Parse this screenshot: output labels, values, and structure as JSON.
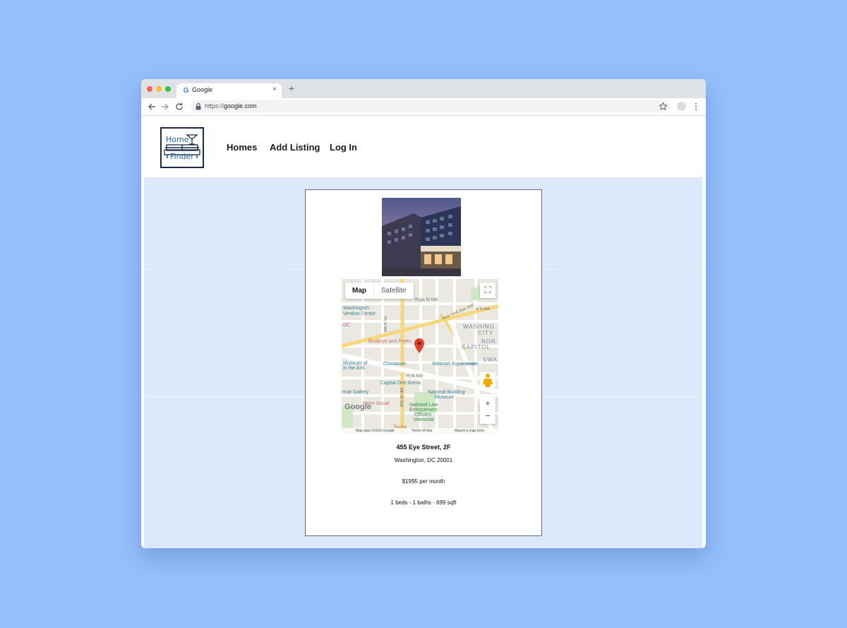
{
  "browser": {
    "tab_title": "Google",
    "tab_favicon": "G",
    "tab_close": "×",
    "new_tab": "+",
    "url_scheme": "https://",
    "url_host": "google.com"
  },
  "site": {
    "logo": {
      "top": "Home",
      "bottom": "Finder"
    },
    "nav": {
      "homes": "Homes",
      "add_listing": "Add Listing",
      "login": "Log In"
    }
  },
  "listing": {
    "map": {
      "tab_map": "Map",
      "tab_satellite": "Satellite",
      "zoom_in": "+",
      "zoom_out": "−",
      "footer_data": "Map data ©2019 Google",
      "footer_terms": "Terms of Use",
      "footer_report": "Report a map error",
      "watermark": "Google",
      "labels": {
        "rigia": "Rigia St NW",
        "nyave": "New York Ave NW",
        "mst": "M St NW",
        "washington_center": "Washington",
        "washington_center2": "Vention Center",
        "dc": "DC",
        "washington": "WASHING",
        "city": "CITY",
        "nor": "NOR",
        "capitol": "CAPITOL",
        "busboys": "Busboys and Poets",
        "museum": "Museum of",
        "in_the_arts": "in the Arts",
        "chinatown": "Chinatown",
        "walmart": "Walmart Supercenter",
        "swa": "SWA",
        "hst": "H St NW",
        "capital_one": "Capital One Arena",
        "portrait": "rtrait Gallery",
        "nbm1": "National Building",
        "nbm2": "Museum",
        "penn": "Penn Social",
        "nleom1": "National Law",
        "nleom2": "Enforcement",
        "nleom3": "Officers",
        "nleom4": "Memorial",
        "rasika": "Rasika",
        "sixth": "6th St NW",
        "seventh": "7th St NW"
      }
    },
    "address_line1": "455 Eye Street, 2F",
    "address_line2": "Washington, DC 20001",
    "price": "$1995 per month",
    "details": "1 beds - 1 baths - 699 sqft"
  }
}
